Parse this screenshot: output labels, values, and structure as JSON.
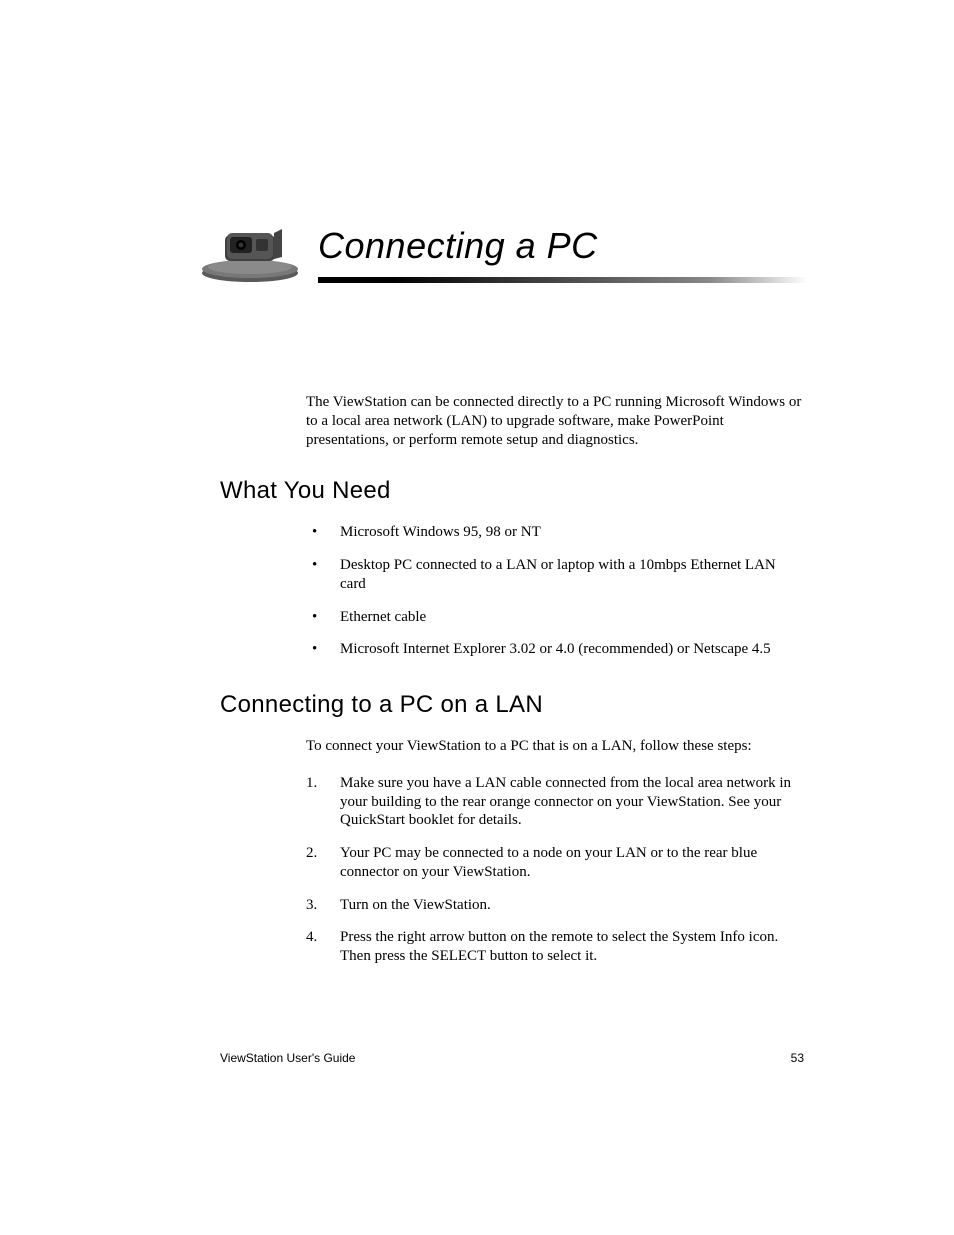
{
  "chapter": {
    "title": "Connecting a PC"
  },
  "intro": "The ViewStation can be connected directly to a PC running Microsoft Windows or to a local area network (LAN) to upgrade software, make PowerPoint presentations, or perform remote setup and diagnostics.",
  "section1": {
    "heading": "What You Need",
    "bullets": [
      "Microsoft Windows 95, 98 or NT",
      "Desktop PC connected to a LAN or laptop with a 10mbps Ethernet LAN card",
      "Ethernet cable",
      "Microsoft Internet Explorer 3.02 or 4.0 (recommended) or Netscape 4.5"
    ]
  },
  "section2": {
    "heading": "Connecting to a PC on a LAN",
    "intro": "To connect your ViewStation to a PC that is on a LAN, follow these steps:",
    "steps": [
      "Make sure you have a LAN cable connected from the local area network in your building to the rear orange connector on your ViewStation. See your QuickStart booklet for details.",
      "Your PC may be connected to a node on your LAN or to the rear blue connector on your ViewStation.",
      "Turn on the ViewStation.",
      "Press the right arrow button on the remote to select the System Info icon. Then press the SELECT button to select it."
    ]
  },
  "footer": {
    "left": "ViewStation User's Guide",
    "right": "53"
  }
}
